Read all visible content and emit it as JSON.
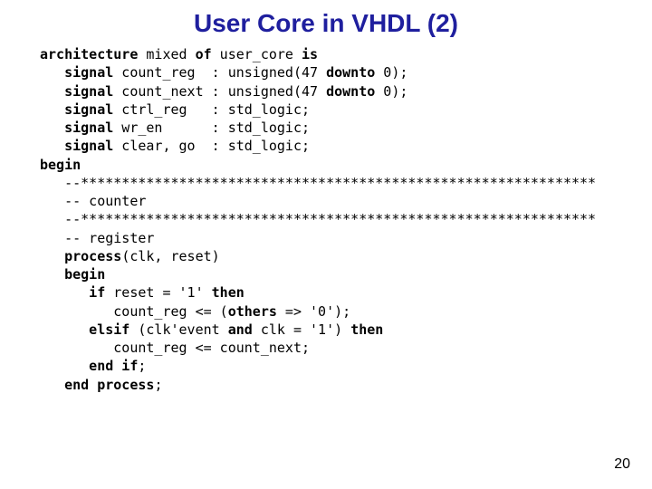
{
  "title": "User Core in VHDL (2)",
  "page_number": "20",
  "code": {
    "l01_a": "architecture",
    "l01_b": " mixed ",
    "l01_c": "of",
    "l01_d": " user_core ",
    "l01_e": "is",
    "l02_a": "   signal",
    "l02_b": " count_reg  : unsigned(47 ",
    "l02_c": "downto",
    "l02_d": " 0);",
    "l03_a": "   signal",
    "l03_b": " count_next : unsigned(47 ",
    "l03_c": "downto",
    "l03_d": " 0);",
    "l04_a": "   signal",
    "l04_b": " ctrl_reg   : std_logic;",
    "l05_a": "   signal",
    "l05_b": " wr_en      : std_logic;",
    "l06_a": "   signal",
    "l06_b": " clear, go  : std_logic;",
    "l07_a": "begin",
    "l08": "   --***************************************************************",
    "l09": "   -- counter",
    "l10": "   --***************************************************************",
    "l11": "   -- register",
    "l12_a": "   process",
    "l12_b": "(clk, reset)",
    "l13_a": "   begin",
    "l14_a": "      if",
    "l14_b": " reset = '1' ",
    "l14_c": "then",
    "l15_a": "         count_reg <= (",
    "l15_b": "others",
    "l15_c": " => '0');",
    "l16_a": "      elsif",
    "l16_b": " (clk'event ",
    "l16_c": "and",
    "l16_d": " clk = '1') ",
    "l16_e": "then",
    "l17": "         count_reg <= count_next;",
    "l18_a": "      end if",
    "l18_b": ";",
    "l19_a": "   end process",
    "l19_b": ";"
  }
}
